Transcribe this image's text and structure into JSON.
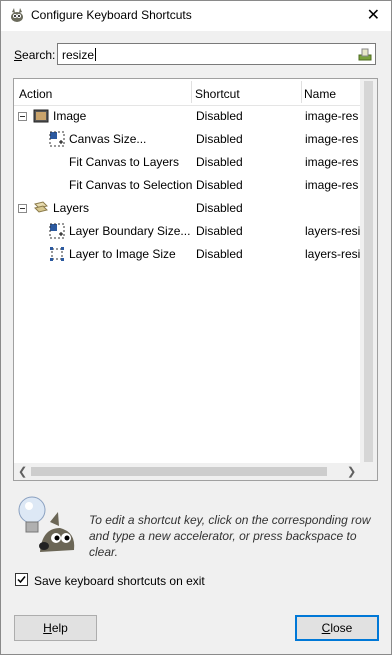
{
  "window": {
    "title": "Configure Keyboard Shortcuts",
    "close_glyph": "✕"
  },
  "search": {
    "label_prefix": "",
    "label_underlined": "S",
    "label_suffix": "earch:",
    "value": "resize"
  },
  "table": {
    "columns": [
      "Action",
      "Shortcut",
      "Name"
    ],
    "rows": [
      {
        "action": "Image",
        "shortcut": "Disabled",
        "name": "image-res",
        "group": true,
        "icon": "image-icon"
      },
      {
        "action": "Canvas Size...",
        "shortcut": "Disabled",
        "name": "image-res",
        "group": false,
        "icon": "canvas-size-icon"
      },
      {
        "action": "Fit Canvas to Layers",
        "shortcut": "Disabled",
        "name": "image-res",
        "group": false,
        "icon": ""
      },
      {
        "action": "Fit Canvas to Selection",
        "shortcut": "Disabled",
        "name": "image-res",
        "group": false,
        "icon": ""
      },
      {
        "action": "Layers",
        "shortcut": "Disabled",
        "name": "",
        "group": true,
        "icon": "layers-icon"
      },
      {
        "action": "Layer Boundary Size...",
        "shortcut": "Disabled",
        "name": "layers-resi",
        "group": false,
        "icon": "layer-boundary-icon"
      },
      {
        "action": "Layer to Image Size",
        "shortcut": "Disabled",
        "name": "layers-resi",
        "group": false,
        "icon": "layer-to-image-icon"
      }
    ]
  },
  "hint": "To edit a shortcut key, click on the corresponding row and type a new accelerator, or press backspace to clear.",
  "save_option": {
    "label": "Save keyboard shortcuts on exit",
    "checked": true
  },
  "buttons": {
    "help": {
      "underlined": "H",
      "rest": "elp"
    },
    "close": {
      "underlined": "C",
      "rest": "lose"
    }
  },
  "colors": {
    "accent": "#0078d7",
    "window_bg": "#f0f0f0",
    "list_bg": "#ffffff"
  }
}
